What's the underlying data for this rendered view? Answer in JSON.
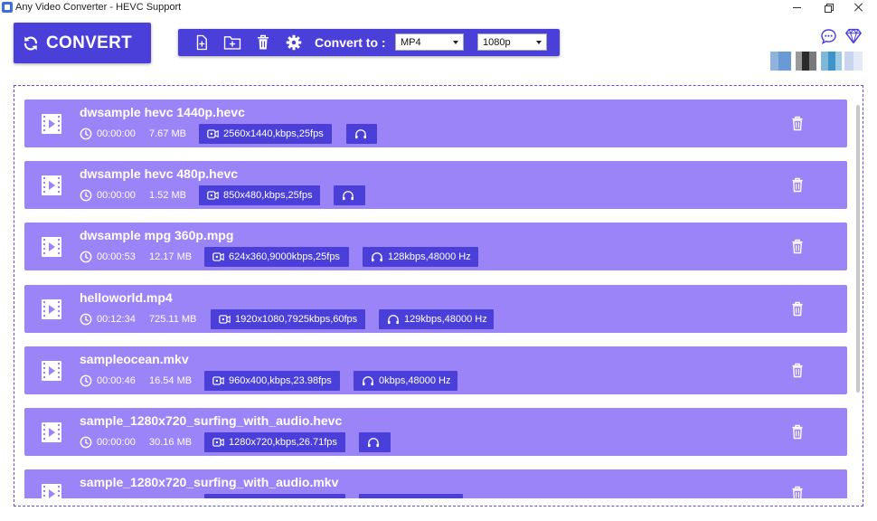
{
  "window": {
    "title": "Any Video Converter - HEVC Support"
  },
  "toolbar": {
    "convert_label": "CONVERT",
    "convert_to_label": "Convert to :",
    "format_value": "MP4",
    "resolution_value": "1080p"
  },
  "colors": {
    "accent": "#4b3fd9",
    "row_background": "#9b84f8",
    "frame_border": "#5b4ee0"
  },
  "files": [
    {
      "name": "dwsample hevc 1440p.hevc",
      "duration": "00:00:00",
      "size": "7.67 MB",
      "video": "2560x1440,kbps,25fps",
      "audio": ""
    },
    {
      "name": "dwsample hevc 480p.hevc",
      "duration": "00:00:00",
      "size": "1.52 MB",
      "video": "850x480,kbps,25fps",
      "audio": ""
    },
    {
      "name": "dwsample mpg 360p.mpg",
      "duration": "00:00:53",
      "size": "12.17 MB",
      "video": "624x360,9000kbps,25fps",
      "audio": "128kbps,48000 Hz"
    },
    {
      "name": "helloworld.mp4",
      "duration": "00:12:34",
      "size": "725.11 MB",
      "video": "1920x1080,7925kbps,60fps",
      "audio": "129kbps,48000 Hz"
    },
    {
      "name": "sampleocean.mkv",
      "duration": "00:00:46",
      "size": "16.54 MB",
      "video": "960x400,kbps,23.98fps",
      "audio": "0kbps,48000 Hz"
    },
    {
      "name": "sample_1280x720_surfing_with_audio.hevc",
      "duration": "00:00:00",
      "size": "30.16 MB",
      "video": "1280x720,kbps,26.71fps",
      "audio": ""
    },
    {
      "name": "sample_1280x720_surfing_with_audio.mkv",
      "duration": "",
      "size": "",
      "video": "",
      "audio": ""
    }
  ]
}
